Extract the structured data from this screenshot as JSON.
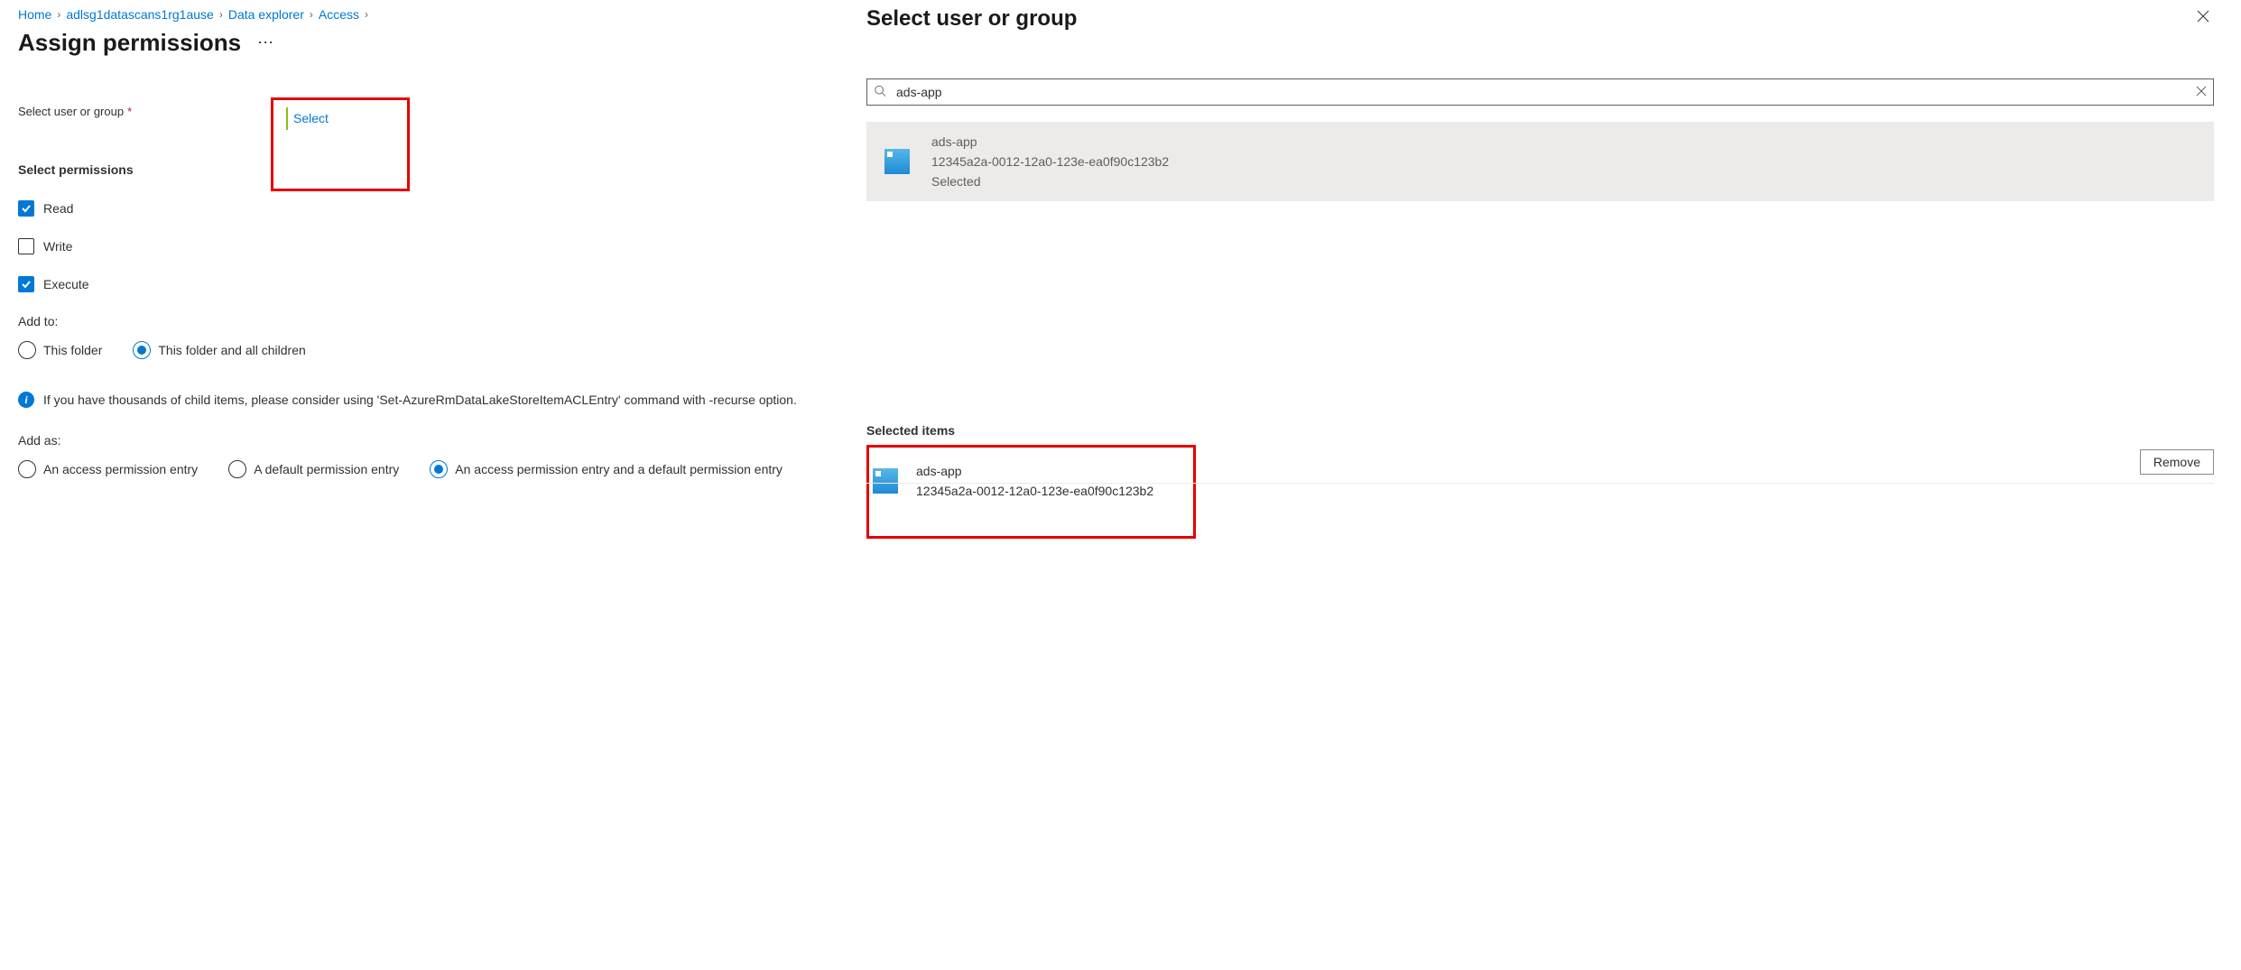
{
  "breadcrumb": {
    "home": "Home",
    "resource": "adlsg1datascans1rg1ause",
    "explorer": "Data explorer",
    "access": "Access"
  },
  "page": {
    "title": "Assign permissions"
  },
  "fields": {
    "select_user_label": "Select user or group",
    "select_link": "Select",
    "permissions_header": "Select permissions",
    "read": "Read",
    "write": "Write",
    "execute": "Execute",
    "add_to_label": "Add to:",
    "add_to_opt1": "This folder",
    "add_to_opt2": "This folder and all children",
    "info_text": "If you have thousands of child items, please consider using 'Set-AzureRmDataLakeStoreItemACLEntry' command with -recurse option.",
    "add_as_label": "Add as:",
    "add_as_opt1": "An access permission entry",
    "add_as_opt2": "A default permission entry",
    "add_as_opt3": "An access permission entry and a default permission entry"
  },
  "panel": {
    "title": "Select user or group",
    "search_value": "ads-app",
    "result": {
      "name": "ads-app",
      "id": "12345a2a-0012-12a0-123e-ea0f90c123b2",
      "status": "Selected"
    },
    "selected_header": "Selected items",
    "selected": {
      "name": "ads-app",
      "id": "12345a2a-0012-12a0-123e-ea0f90c123b2"
    },
    "remove_label": "Remove"
  }
}
